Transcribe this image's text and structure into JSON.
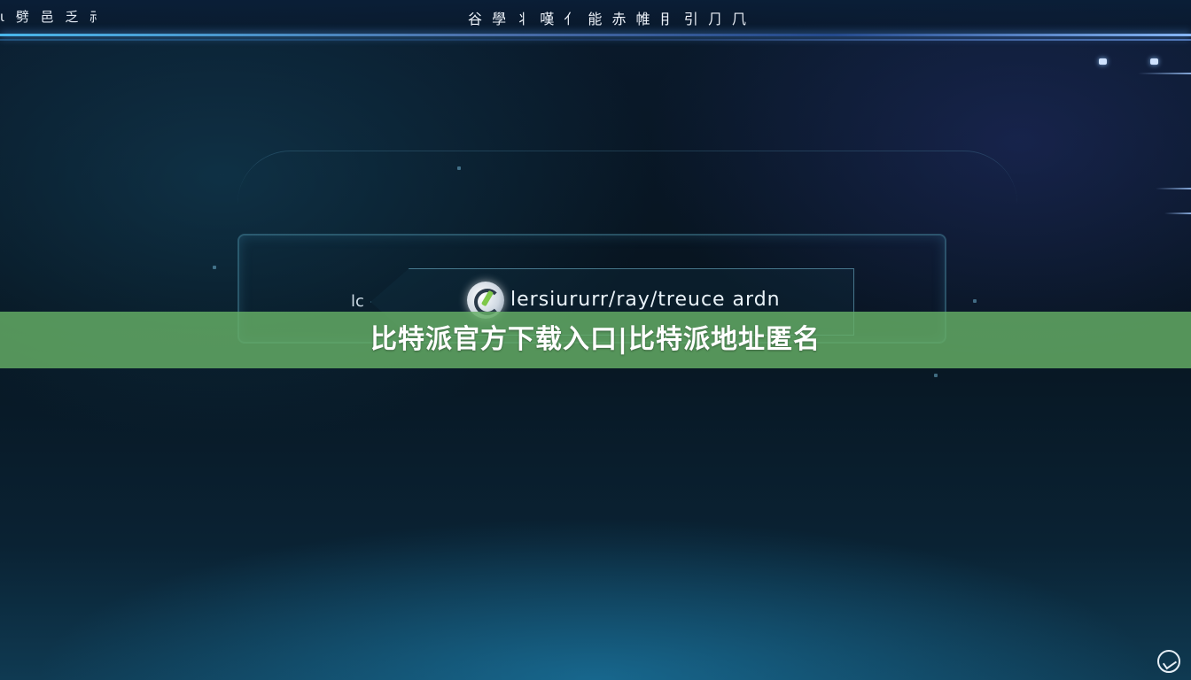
{
  "header": {
    "left_text": "ι 劈 ⾢ 乏 ⺬",
    "center_text": "⾕ 學 ⺦ 嘆 ⺅ 能 ⾚ 帷 ⺝ 引 ⺆ ⺇"
  },
  "frame": {
    "left_mark": "lc",
    "logo_icon": "checkmark-circle-logo",
    "text": "lersiururr/ray/treuce ardn"
  },
  "banner": {
    "title": "比特派官方下载入口|比特派地址匿名",
    "color": "#66b066"
  },
  "corner": {
    "icon": "watermark-check-icon"
  }
}
